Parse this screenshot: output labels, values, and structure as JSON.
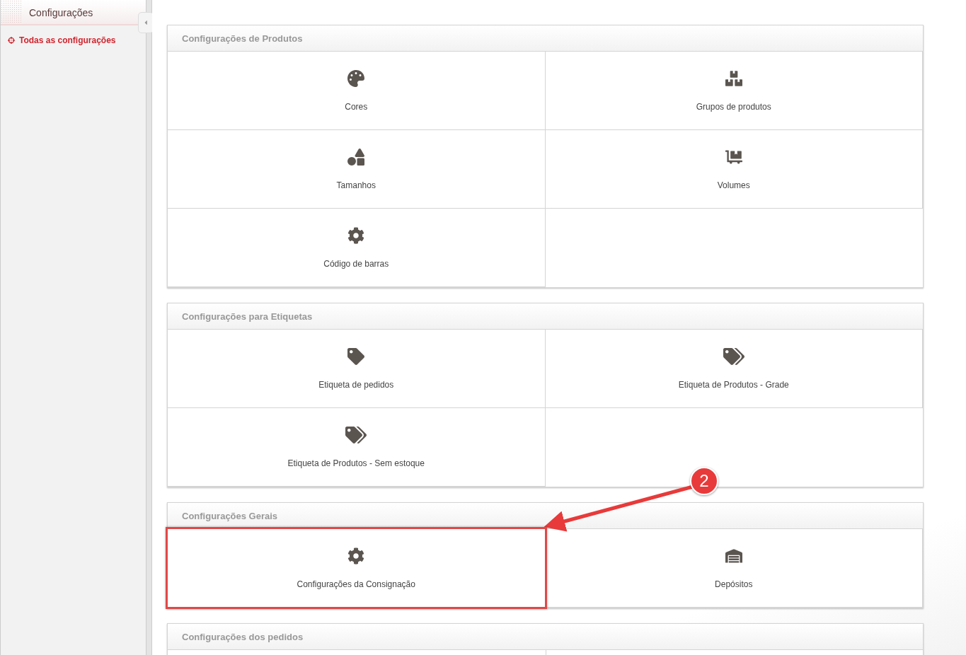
{
  "sidebar": {
    "title": "Configurações",
    "link": "Todas as configurações"
  },
  "panels": [
    {
      "title": "Configurações de Produtos",
      "items": [
        {
          "label": "Cores",
          "kind": "palette",
          "highlighted": false
        },
        {
          "label": "Grupos de produtos",
          "kind": "boxes",
          "highlighted": false
        },
        {
          "label": "Tamanhos",
          "kind": "shapes",
          "highlighted": false
        },
        {
          "label": "Volumes",
          "kind": "dolly",
          "highlighted": false
        },
        {
          "label": "Código de barras",
          "kind": "gear",
          "highlighted": false
        }
      ]
    },
    {
      "title": "Configurações para Etiquetas",
      "items": [
        {
          "label": "Etiqueta de pedidos",
          "kind": "tag",
          "highlighted": false
        },
        {
          "label": "Etiqueta de Produtos - Grade",
          "kind": "tags",
          "highlighted": false
        },
        {
          "label": "Etiqueta de Produtos - Sem estoque",
          "kind": "tags",
          "highlighted": false
        }
      ]
    },
    {
      "title": "Configurações Gerais",
      "items": [
        {
          "label": "Configurações da Consignação",
          "kind": "gear",
          "highlighted": true
        },
        {
          "label": "Depósitos",
          "kind": "warehouse",
          "highlighted": false
        }
      ]
    },
    {
      "title": "Configurações dos pedidos"
    }
  ],
  "annotation": {
    "label": "2"
  }
}
